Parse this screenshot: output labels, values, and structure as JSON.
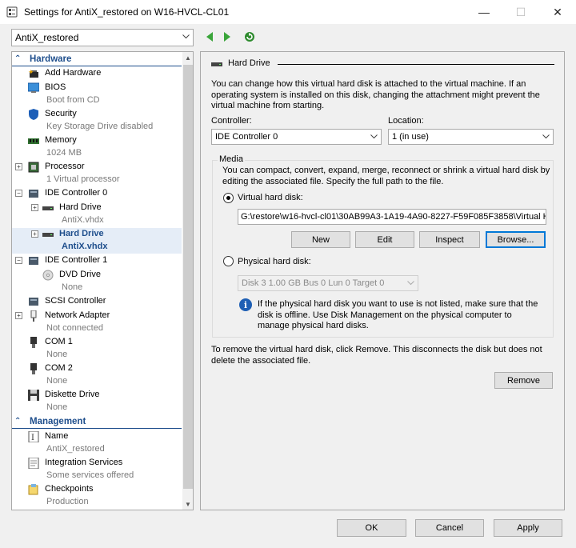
{
  "window": {
    "title": "Settings for AntiX_restored on W16-HVCL-CL01",
    "minimize": "—",
    "maximize": "☐",
    "close": "✕"
  },
  "toolbar": {
    "vm_name": "AntiX_restored"
  },
  "tree": {
    "hardware_header": "Hardware",
    "management_header": "Management",
    "items": [
      {
        "label": "Add Hardware",
        "sub": ""
      },
      {
        "label": "BIOS",
        "sub": "Boot from CD"
      },
      {
        "label": "Security",
        "sub": "Key Storage Drive disabled"
      },
      {
        "label": "Memory",
        "sub": "1024 MB"
      },
      {
        "label": "Processor",
        "sub": "1 Virtual processor"
      },
      {
        "label": "IDE Controller 0",
        "sub": ""
      },
      {
        "label": "Hard Drive",
        "sub": "AntiX.vhdx"
      },
      {
        "label": "Hard Drive",
        "sub": "AntiX.vhdx"
      },
      {
        "label": "IDE Controller 1",
        "sub": ""
      },
      {
        "label": "DVD Drive",
        "sub": "None"
      },
      {
        "label": "SCSI Controller",
        "sub": ""
      },
      {
        "label": "Network Adapter",
        "sub": "Not connected"
      },
      {
        "label": "COM 1",
        "sub": "None"
      },
      {
        "label": "COM 2",
        "sub": "None"
      },
      {
        "label": "Diskette Drive",
        "sub": "None"
      },
      {
        "label": "Name",
        "sub": "AntiX_restored"
      },
      {
        "label": "Integration Services",
        "sub": "Some services offered"
      },
      {
        "label": "Checkpoints",
        "sub": "Production"
      }
    ]
  },
  "panel": {
    "section_title": "Hard Drive",
    "intro": "You can change how this virtual hard disk is attached to the virtual machine. If an operating system is installed on this disk, changing the attachment might prevent the virtual machine from starting.",
    "controller_label": "Controller:",
    "controller_value": "IDE Controller 0",
    "location_label": "Location:",
    "location_value": "1 (in use)",
    "media_label": "Media",
    "media_desc": "You can compact, convert, expand, merge, reconnect or shrink a virtual hard disk by editing the associated file. Specify the full path to the file.",
    "vhd_label": "Virtual hard disk:",
    "vhd_path": "G:\\restore\\w16-hvcl-cl01\\30AB99A3-1A19-4A90-8227-F59F085F3858\\Virtual H",
    "btn_new": "New",
    "btn_edit": "Edit",
    "btn_inspect": "Inspect",
    "btn_browse": "Browse...",
    "phys_label": "Physical hard disk:",
    "phys_value": "Disk 3 1.00 GB Bus 0 Lun 0 Target 0",
    "info_text": "If the physical hard disk you want to use is not listed, make sure that the disk is offline. Use Disk Management on the physical computer to manage physical hard disks.",
    "remove_text": "To remove the virtual hard disk, click Remove. This disconnects the disk but does not delete the associated file.",
    "btn_remove": "Remove"
  },
  "footer": {
    "ok": "OK",
    "cancel": "Cancel",
    "apply": "Apply"
  },
  "colors": {
    "accent": "#1e4e8c",
    "nav_green": "#3aa53a",
    "focus": "#0078d7"
  }
}
